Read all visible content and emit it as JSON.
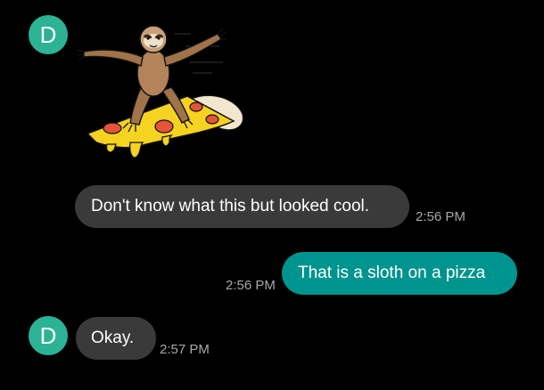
{
  "colors": {
    "background": "#000000",
    "avatar_bg": "#2bb394",
    "incoming_bubble": "#3a3a3a",
    "outgoing_bubble": "#00948f",
    "timestamp_text": "#a8a8a8"
  },
  "conversation": {
    "contact_initial": "D",
    "messages": [
      {
        "type": "sticker",
        "direction": "incoming",
        "sticker_icon": "sloth-surfing-pizza-sticker"
      },
      {
        "type": "text",
        "direction": "incoming",
        "text": "Don't know what this but looked cool.",
        "time": "2:56 PM"
      },
      {
        "type": "text",
        "direction": "outgoing",
        "text": "That is a sloth on a pizza",
        "time": "2:56 PM"
      },
      {
        "type": "text",
        "direction": "incoming",
        "text": "Okay.",
        "time": "2:57 PM"
      }
    ]
  }
}
